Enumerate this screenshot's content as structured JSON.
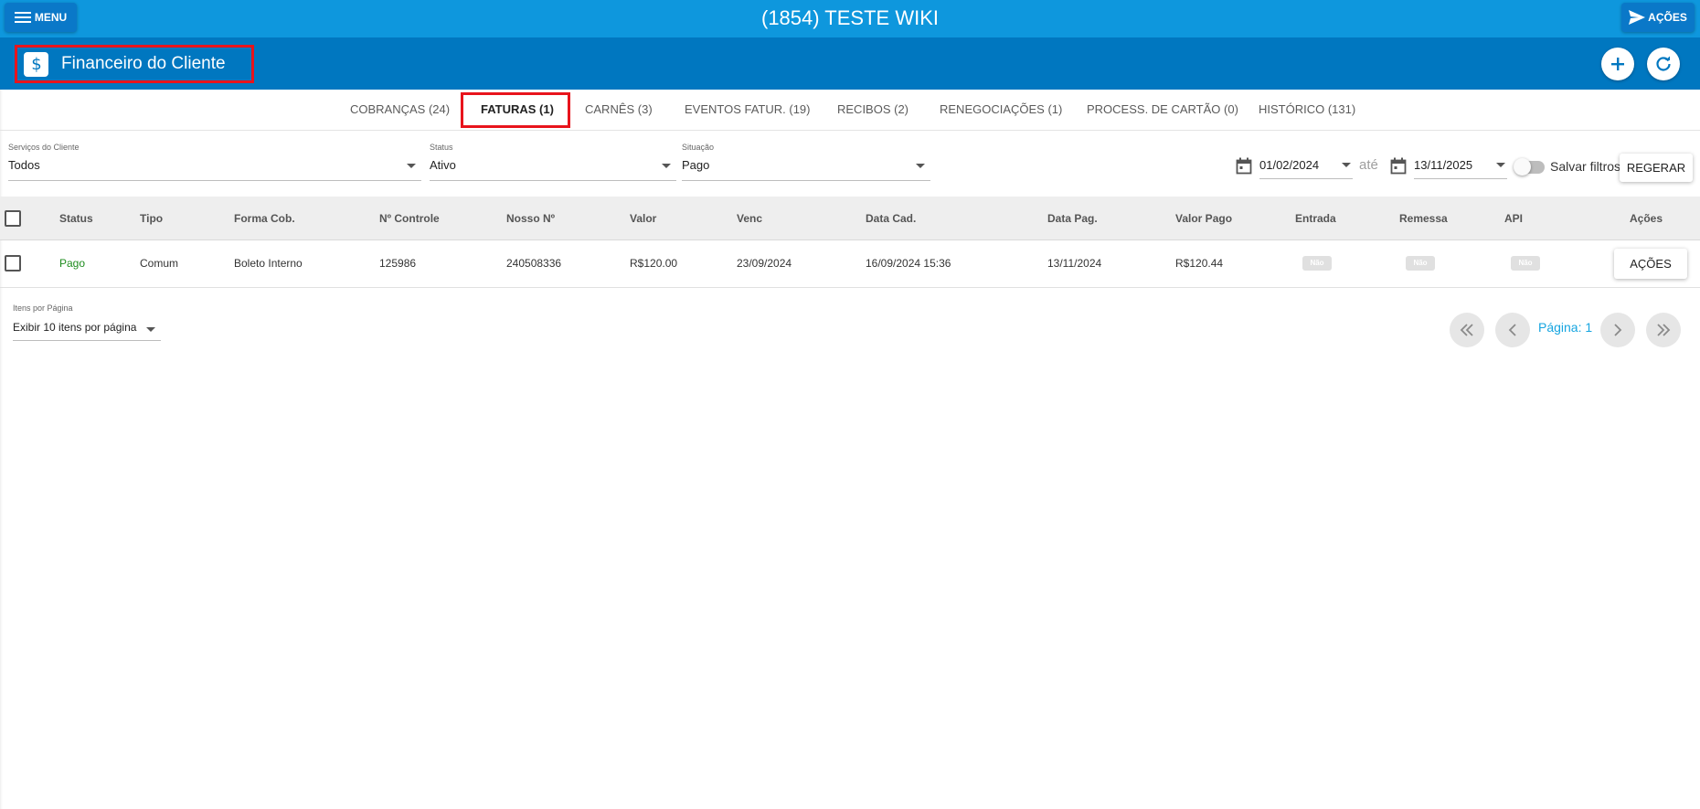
{
  "topbar": {
    "menu_label": "MENU",
    "title": "(1854) TESTE WIKI",
    "actions_label": "AÇÕES",
    "menu_icon": "hamburger-icon",
    "actions_icon": "send-icon"
  },
  "module": {
    "title": "Financeiro do Cliente",
    "icon": "dollar-icon",
    "add_icon": "plus-icon",
    "refresh_icon": "refresh-icon"
  },
  "tabs": [
    {
      "label": "COBRANÇAS (24)",
      "active": false
    },
    {
      "label": "FATURAS (1)",
      "active": true
    },
    {
      "label": "CARNÊS (3)",
      "active": false
    },
    {
      "label": "EVENTOS FATUR. (19)",
      "active": false
    },
    {
      "label": "RECIBOS (2)",
      "active": false
    },
    {
      "label": "RENEGOCIAÇÕES (1)",
      "active": false
    },
    {
      "label": "PROCESS. DE CARTÃO (0)",
      "active": false
    },
    {
      "label": "HISTÓRICO (131)",
      "active": false
    }
  ],
  "filters": {
    "services": {
      "label": "Serviços do Cliente",
      "value": "Todos"
    },
    "status": {
      "label": "Status",
      "value": "Ativo"
    },
    "situation": {
      "label": "Situação",
      "value": "Pago"
    },
    "date_from": "01/02/2024",
    "date_sep": "até",
    "date_to": "13/11/2025",
    "save_filters_label": "Salvar filtros",
    "save_filters_on": false,
    "regenerate_label": "REGERAR"
  },
  "table": {
    "columns": [
      "Status",
      "Tipo",
      "Forma Cob.",
      "Nº Controle",
      "Nosso Nº",
      "Valor",
      "Venc",
      "Data Cad.",
      "Data Pag.",
      "Valor Pago",
      "Entrada",
      "Remessa",
      "API",
      "Ações"
    ],
    "rows": [
      {
        "status": "Pago",
        "tipo": "Comum",
        "forma_cob": "Boleto Interno",
        "controle": "125986",
        "nosso_num": "240508336",
        "valor": "R$120.00",
        "venc": "23/09/2024",
        "data_cad": "16/09/2024 15:36",
        "data_pag": "13/11/2024",
        "valor_pago": "R$120.44",
        "entrada": "Não",
        "remessa": "Não",
        "api": "Não",
        "acoes_label": "AÇÕES"
      }
    ],
    "status_color": "#1e8c1e"
  },
  "pagination": {
    "per_page_label": "Itens por Página",
    "per_page_value": "Exibir 10 itens por página",
    "page_label": "Página: 1"
  },
  "colors": {
    "topbar": "#0e97dd",
    "module_bar": "#0077c0",
    "highlight": "#e8141c",
    "page_accent": "#16a5e0"
  }
}
